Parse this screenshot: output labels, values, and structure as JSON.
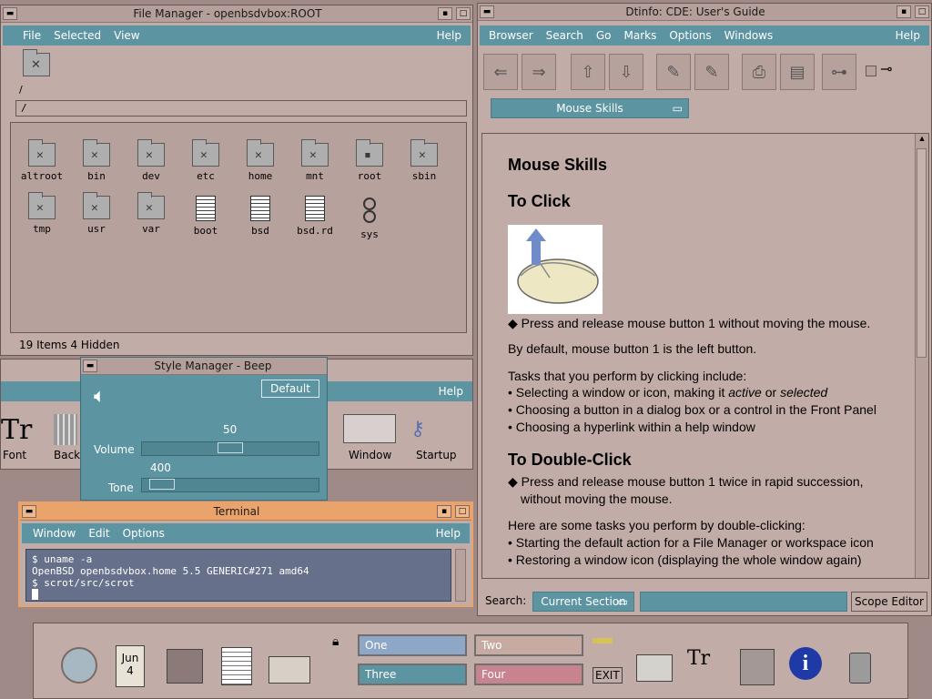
{
  "file_manager": {
    "title": "File Manager - openbsdvbox:ROOT",
    "menu": [
      "File",
      "Selected",
      "View"
    ],
    "help": "Help",
    "path_label": "/",
    "path_value": "/",
    "items": [
      {
        "name": "altroot",
        "type": "folder"
      },
      {
        "name": "bin",
        "type": "folder"
      },
      {
        "name": "dev",
        "type": "folder"
      },
      {
        "name": "etc",
        "type": "folder"
      },
      {
        "name": "home",
        "type": "folder"
      },
      {
        "name": "mnt",
        "type": "folder"
      },
      {
        "name": "root",
        "type": "locked-folder"
      },
      {
        "name": "sbin",
        "type": "folder"
      },
      {
        "name": "tmp",
        "type": "folder"
      },
      {
        "name": "usr",
        "type": "folder"
      },
      {
        "name": "var",
        "type": "folder"
      },
      {
        "name": "boot",
        "type": "file"
      },
      {
        "name": "bsd",
        "type": "file"
      },
      {
        "name": "bsd.rd",
        "type": "file"
      },
      {
        "name": "sys",
        "type": "link"
      }
    ],
    "status": "19 Items 4 Hidden"
  },
  "dtinfo": {
    "title": "Dtinfo: CDE: User's Guide",
    "menu": [
      "Browser",
      "Search",
      "Go",
      "Marks",
      "Options",
      "Windows"
    ],
    "help": "Help",
    "section_dropdown": "Mouse Skills",
    "heading1": "Mouse Skills",
    "heading2": "To Click",
    "click_bullet": "Press and release mouse button 1 without moving the mouse.",
    "by_default": "By default, mouse button 1 is the left button.",
    "tasks_intro": "Tasks that you perform by clicking include:",
    "task1_a": "Selecting a window or icon, making it ",
    "task1_italic1": "active",
    "task1_b": " or ",
    "task1_italic2": "selected",
    "task2": "Choosing a button in a dialog box or a control in the Front Panel",
    "task3": "Choosing a hyperlink within a help window",
    "heading3": "To Double-Click",
    "dbl_bullet_line1": "Press and release mouse button 1 twice in rapid succession,",
    "dbl_bullet_line2": "without moving the mouse.",
    "dbl_intro": "Here are some tasks you perform by double-clicking:",
    "dbl_task1": "Starting the default action for a File Manager or workspace icon",
    "dbl_task2": "Restoring a window icon (displaying the whole window again)",
    "search_label": "Search:",
    "scope_option": "Current Section",
    "scope_editor": "Scope Editor"
  },
  "style_manager": {
    "title": "Style Manager - Beep",
    "default_button": "Default",
    "volume_label": "Volume",
    "volume_value": "50",
    "volume_fraction": 0.5,
    "tone_label": "Tone",
    "tone_value": "400",
    "tone_fraction": 0.05,
    "help": "Help",
    "icons_left": [
      "Font",
      "Back"
    ],
    "icons_right": [
      "Window",
      "Startup"
    ]
  },
  "terminal": {
    "title": "Terminal",
    "menu": [
      "Window",
      "Edit",
      "Options"
    ],
    "help": "Help",
    "lines": [
      "$ uname -a",
      "OpenBSD openbsdvbox.home 5.5 GENERIC#271 amd64",
      "$ scrot/src/scrot"
    ]
  },
  "front_panel": {
    "date_month": "Jun",
    "date_day": "4",
    "workspaces": [
      "One",
      "Two",
      "Three",
      "Four"
    ],
    "exit": "EXIT"
  }
}
